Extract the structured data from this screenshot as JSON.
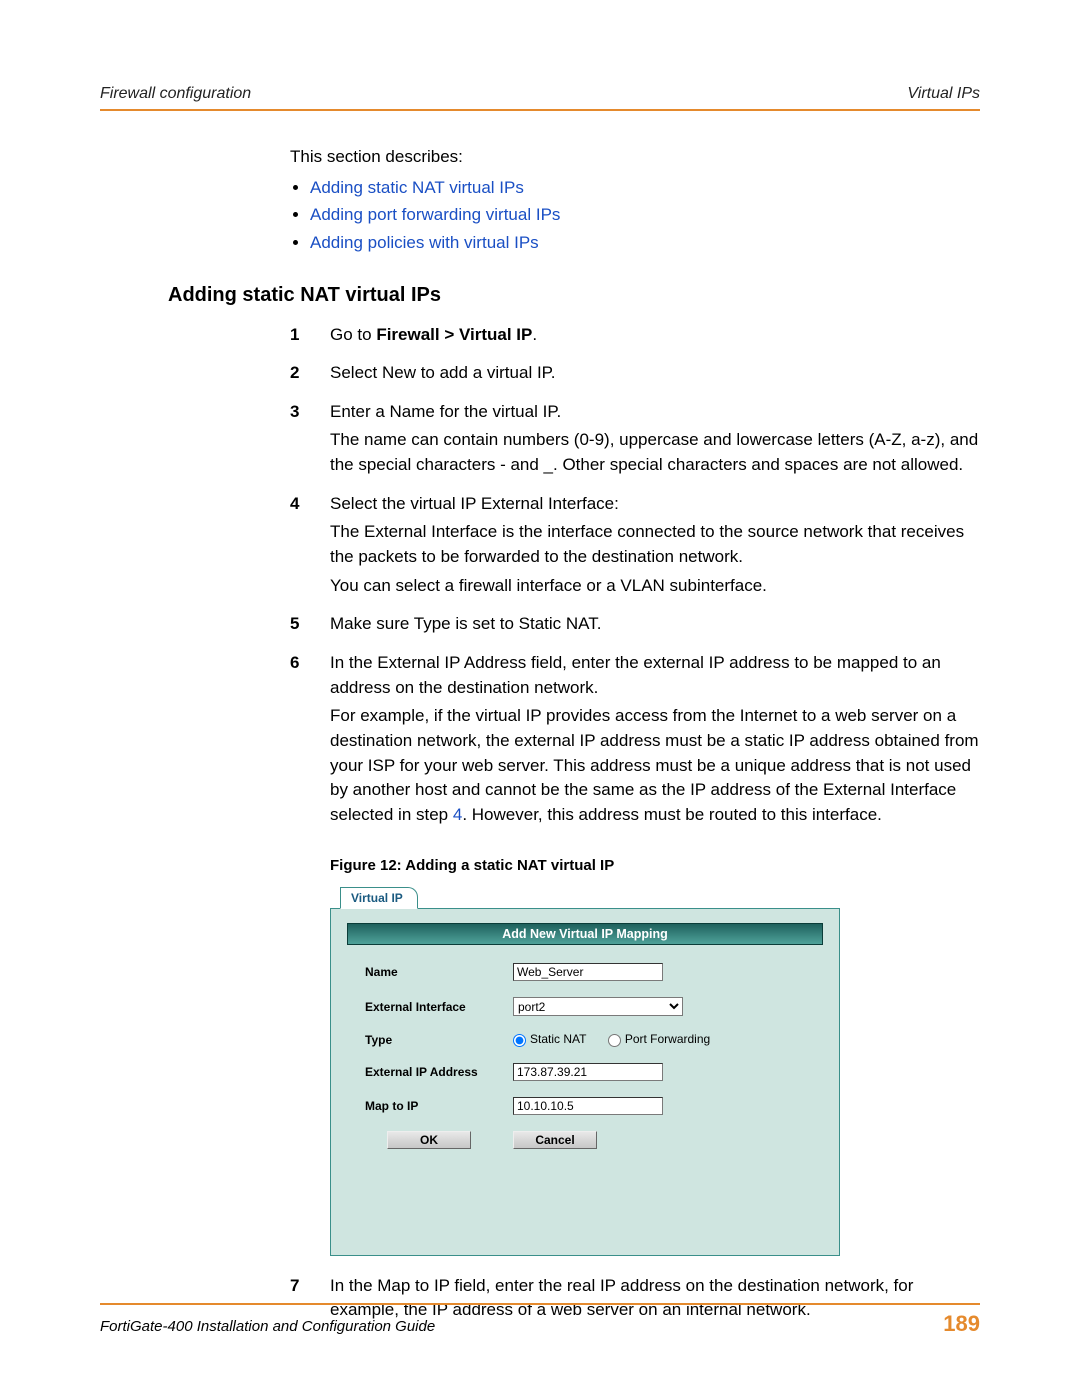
{
  "header": {
    "left": "Firewall configuration",
    "right": "Virtual IPs"
  },
  "intro": {
    "lead": "This section describes:",
    "links": [
      "Adding static NAT virtual IPs",
      "Adding port forwarding virtual IPs",
      "Adding policies with virtual IPs"
    ]
  },
  "heading": "Adding static NAT virtual IPs",
  "steps": [
    {
      "n": "1",
      "paras": [
        {
          "type": "richtext",
          "runs": [
            "Go to ",
            {
              "b": true,
              "t": "Firewall > Virtual IP"
            },
            "."
          ]
        }
      ]
    },
    {
      "n": "2",
      "paras": [
        "Select New to add a virtual IP."
      ]
    },
    {
      "n": "3",
      "paras": [
        "Enter a Name for the virtual IP.",
        "The name can contain numbers (0-9), uppercase and lowercase letters (A-Z, a-z), and the special characters - and _. Other special characters and spaces are not allowed."
      ]
    },
    {
      "n": "4",
      "paras": [
        "Select the virtual IP External Interface:",
        "The External Interface is the interface connected to the source network that receives the packets to be forwarded to the destination network.",
        "You can select a firewall interface or a VLAN subinterface."
      ]
    },
    {
      "n": "5",
      "paras": [
        "Make sure Type is set to Static NAT."
      ]
    },
    {
      "n": "6",
      "paras": [
        "In the External IP Address field, enter the external IP address to be mapped to an address on the destination network.",
        {
          "type": "richtext",
          "runs": [
            "For example, if the virtual IP provides access from the Internet to a web server on a destination network, the external IP address must be a static IP address obtained from your ISP for your web server. This address must be a unique address that is not used by another host and cannot be the same as the IP address of the External Interface selected in step ",
            {
              "link": true,
              "t": "4"
            },
            ". However, this address must be routed to this interface."
          ]
        }
      ]
    },
    {
      "n": "7",
      "paras": [
        "In the Map to IP field, enter the real IP address on the destination network, for example, the IP address of a web server on an internal network."
      ]
    }
  ],
  "figure": {
    "caption": "Figure 12: Adding a static NAT virtual IP",
    "tab": "Virtual IP",
    "title": "Add New Virtual IP Mapping",
    "fields": {
      "name": {
        "label": "Name",
        "value": "Web_Server"
      },
      "ext_iface": {
        "label": "External Interface",
        "value": "port2"
      },
      "type": {
        "label": "Type",
        "opt_static": "Static NAT",
        "opt_pf": "Port Forwarding",
        "selected": "static"
      },
      "ext_ip": {
        "label": "External IP Address",
        "value": "173.87.39.21"
      },
      "map_ip": {
        "label": "Map to IP",
        "value": "10.10.10.5"
      }
    },
    "buttons": {
      "ok": "OK",
      "cancel": "Cancel"
    }
  },
  "footer": {
    "guide": "FortiGate-400 Installation and Configuration Guide",
    "page": "189"
  }
}
